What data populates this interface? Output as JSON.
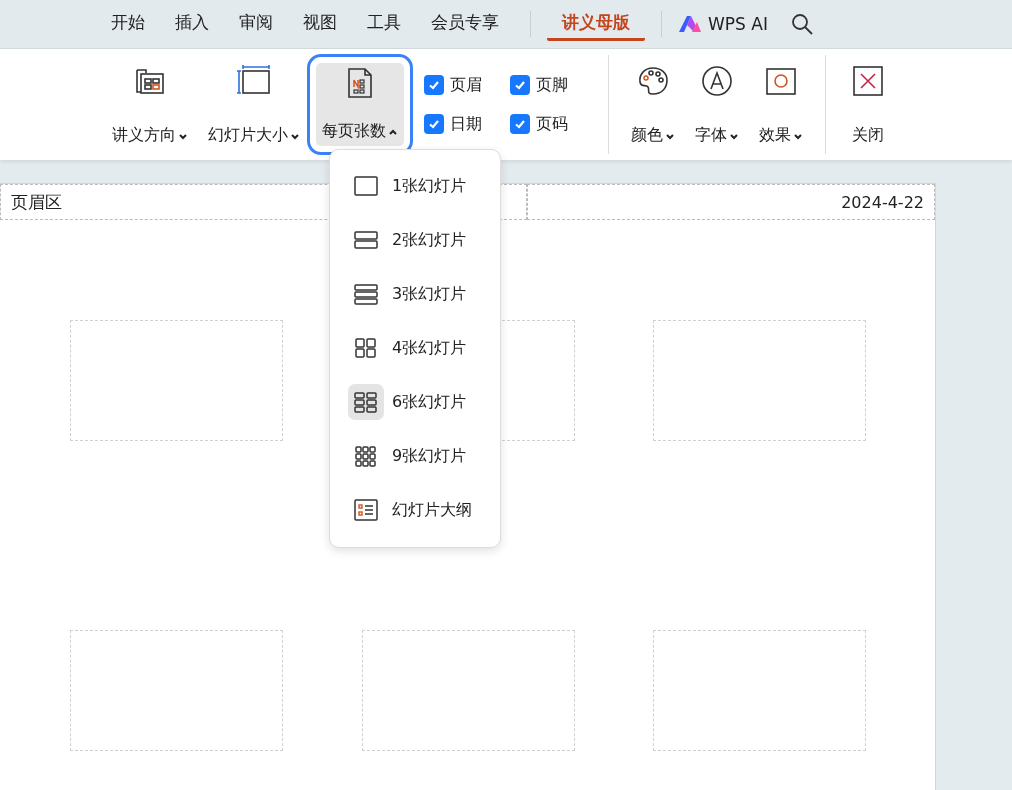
{
  "menu_tabs": [
    {
      "label": "开始",
      "selected": false
    },
    {
      "label": "插入",
      "selected": false
    },
    {
      "label": "审阅",
      "selected": false
    },
    {
      "label": "视图",
      "selected": false
    },
    {
      "label": "工具",
      "selected": false
    },
    {
      "label": "会员专享",
      "selected": false
    },
    {
      "label": "讲义母版",
      "selected": true
    }
  ],
  "ai_button": {
    "label": "WPS AI"
  },
  "ribbon": {
    "layout_buttons": [
      {
        "label": "讲义方向",
        "kind": "orientation",
        "expanded": false
      },
      {
        "label": "幻灯片大小",
        "kind": "size",
        "expanded": false
      },
      {
        "label": "每页张数",
        "kind": "per_page",
        "expanded": true
      }
    ],
    "checkboxes": [
      {
        "label": "页眉",
        "checked": true
      },
      {
        "label": "页脚",
        "checked": true
      },
      {
        "label": "日期",
        "checked": true
      },
      {
        "label": "页码",
        "checked": true
      }
    ],
    "theme_buttons": [
      {
        "label": "颜色",
        "kind": "color"
      },
      {
        "label": "字体",
        "kind": "font"
      },
      {
        "label": "效果",
        "kind": "effect"
      }
    ],
    "close_button": {
      "label": "关闭"
    }
  },
  "dropdown": [
    {
      "label": "1张幻灯片",
      "kind": "one",
      "selected": false
    },
    {
      "label": "2张幻灯片",
      "kind": "two",
      "selected": false
    },
    {
      "label": "3张幻灯片",
      "kind": "three",
      "selected": false
    },
    {
      "label": "4张幻灯片",
      "kind": "four",
      "selected": false
    },
    {
      "label": "6张幻灯片",
      "kind": "six",
      "selected": true
    },
    {
      "label": "9张幻灯片",
      "kind": "nine",
      "selected": false
    },
    {
      "label": "幻灯片大纲",
      "kind": "outline",
      "selected": false
    }
  ],
  "page": {
    "header": "页眉区",
    "date": "2024-4-22"
  }
}
